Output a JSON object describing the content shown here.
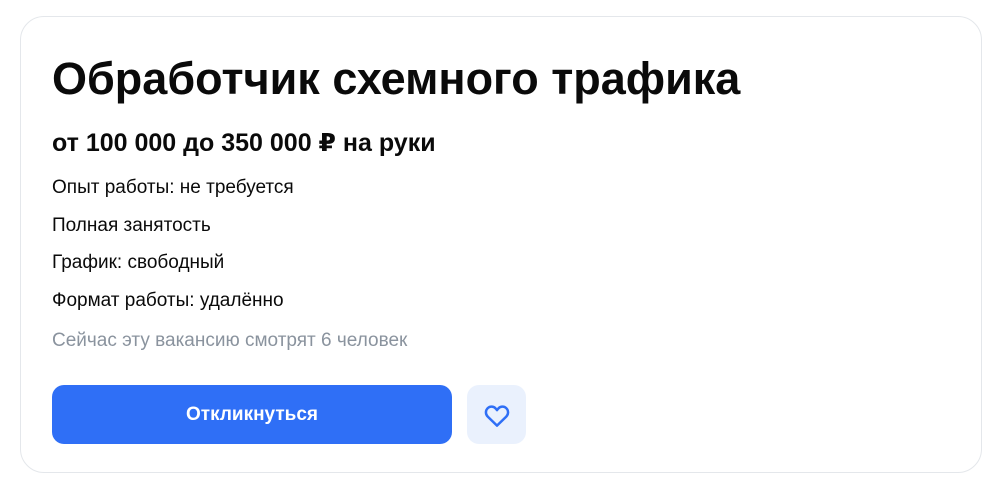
{
  "vacancy": {
    "title": "Обработчик схемного трафика",
    "salary": "от 100 000 до 350 000 ₽ на руки",
    "details": [
      "Опыт работы: не требуется",
      "Полная занятость",
      "График: свободный",
      "Формат работы: удалённо"
    ],
    "viewers_text": "Сейчас эту вакансию смотрят 6 человек"
  },
  "actions": {
    "apply_label": "Откликнуться",
    "favorite_icon": "heart-icon"
  },
  "colors": {
    "accent": "#2f6ff6",
    "favorite_bg": "#eaf1fd",
    "muted_text": "#8a939e",
    "card_border": "#e4e7eb"
  }
}
